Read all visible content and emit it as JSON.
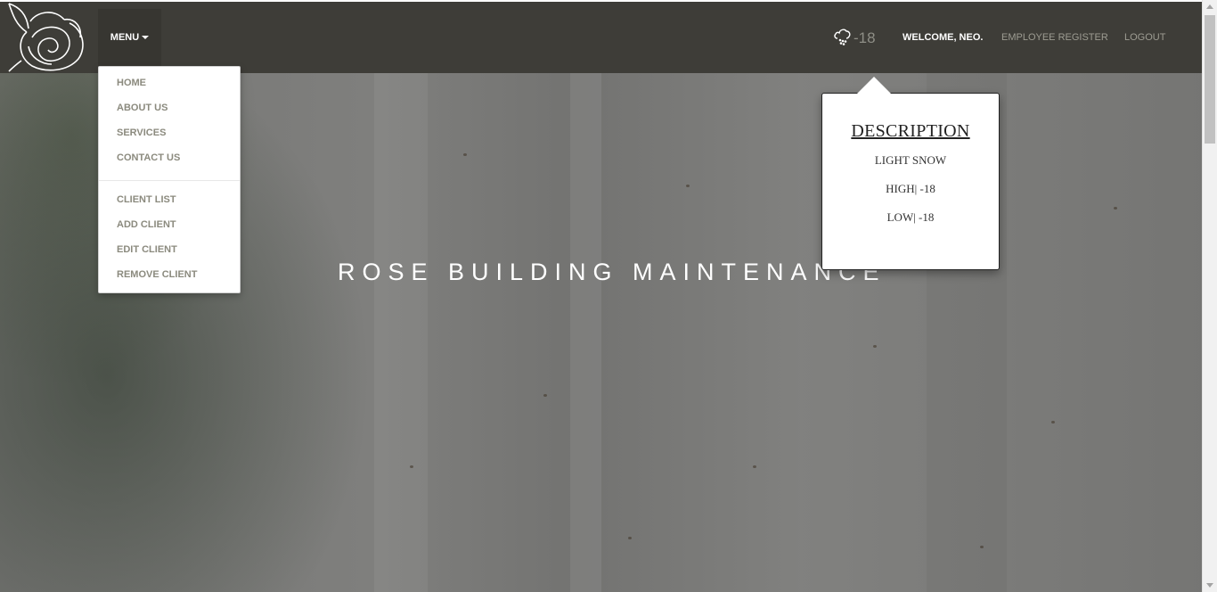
{
  "navbar": {
    "menu_label": "MENU",
    "weather_temp": "-18",
    "welcome": "WELCOME, NEO.",
    "employee_register": "EMPLOYEE REGISTER",
    "logout": "LOGOUT",
    "background_color": "#3e3d38"
  },
  "dropdown": {
    "items": [
      {
        "label": "HOME"
      },
      {
        "label": "ABOUT US"
      },
      {
        "label": "SERVICES"
      },
      {
        "label": "CONTACT US"
      },
      {
        "label": "CLIENT LIST"
      },
      {
        "label": "ADD CLIENT"
      },
      {
        "label": "EDIT CLIENT"
      },
      {
        "label": "REMOVE CLIENT"
      }
    ]
  },
  "weather_popover": {
    "title": "DESCRIPTION",
    "condition": "LIGHT SNOW",
    "high": "HIGH| -18",
    "low": "LOW| -18",
    "icon": "snow-cloud-icon"
  },
  "hero": {
    "title": "ROSE BUILDING MAINTENANCE"
  }
}
